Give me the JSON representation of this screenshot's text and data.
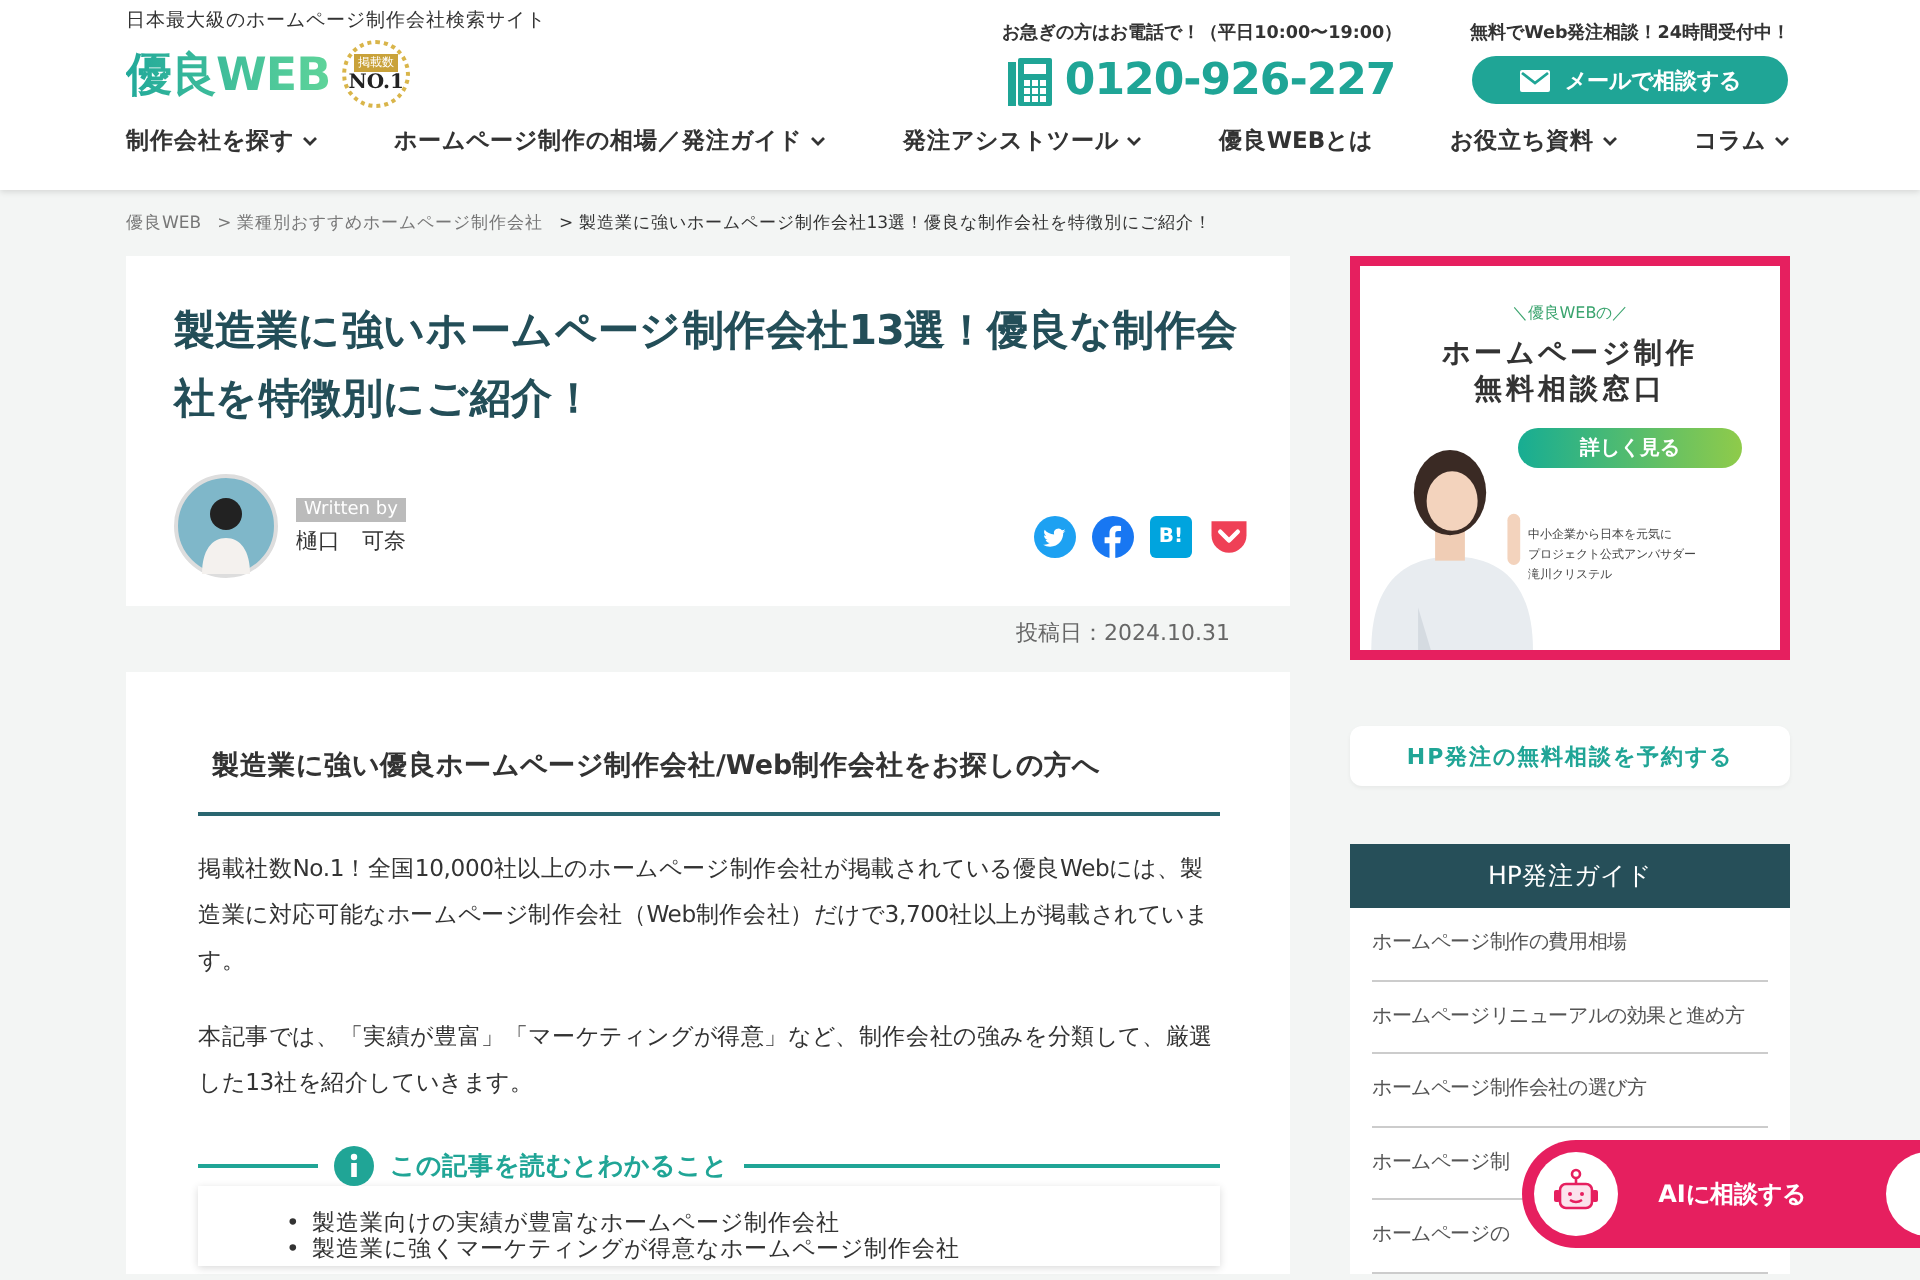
{
  "header": {
    "tagline": "日本最大級のホームページ制作会社検索サイト",
    "logo": "優良WEB",
    "badge": {
      "top": "掲載数",
      "main": "NO.1"
    },
    "phone_note": "お急ぎの方はお電話で！（平日10:00〜19:00）",
    "phone": "0120-926-227",
    "mail_note": "無料でWeb発注相談！24時間受付中！",
    "mail_button": "メールで相談する"
  },
  "nav": [
    {
      "label": "制作会社を探す",
      "dropdown": true
    },
    {
      "label": "ホームページ制作の相場／発注ガイド",
      "dropdown": true
    },
    {
      "label": "発注アシストツール",
      "dropdown": true
    },
    {
      "label": "優良WEBとは",
      "dropdown": false
    },
    {
      "label": "お役立ち資料",
      "dropdown": true
    },
    {
      "label": "コラム",
      "dropdown": true
    }
  ],
  "breadcrumbs": [
    "優良WEB",
    "> 業種別おすすめホームページ制作会社",
    "> 製造業に強いホームページ制作会社13選！優良な制作会社を特徴別にご紹介！"
  ],
  "article": {
    "title": "製造業に強いホームページ制作会社13選！優良な制作会社を特徴別にご紹介！",
    "author_label": "Written by",
    "author": "樋口　可奈",
    "share": [
      {
        "kind": "twitter"
      },
      {
        "kind": "facebook"
      },
      {
        "kind": "hatena",
        "label": "B!"
      },
      {
        "kind": "pocket"
      }
    ],
    "posted": "投稿日：2024.10.31",
    "section_heading": "製造業に強い優良ホームページ制作会社/Web制作会社をお探しの方へ",
    "paragraphs": [
      "掲載社数No.1！全国10,000社以上のホームページ制作会社が掲載されている優良Webには、製造業に対応可能なホームページ制作会社（Web制作会社）だけで3,700社以上が掲載されています。",
      "本記事では、「実績が豊富」「マーケティングが得意」など、制作会社の強みを分類して、厳選した13社を紹介していきます。"
    ],
    "summary": {
      "title": "この記事を読むとわかること",
      "bullet": "•",
      "items": [
        "製造業向けの実績が豊富なホームページ制作会社",
        "製造業に強くマーケティングが得意なホームページ制作会社"
      ]
    }
  },
  "sidebar": {
    "banner": {
      "kicker": "＼優良WEBの／",
      "headline": [
        "ホームページ制作",
        "無料相談窓口"
      ],
      "button": "詳しく見る",
      "caption": [
        "中小企業から日本を元気に",
        "プロジェクト公式アンバサダー",
        "滝川クリステル"
      ]
    },
    "reserve_button": "HP発注の無料相談を予約する",
    "guide": {
      "title": "HP発注ガイド",
      "items": [
        "ホームページ制作の費用相場",
        "ホームページリニューアルの効果と進め方",
        "ホームページ制作会社の選び方",
        "ホームページ制",
        "ホームページの"
      ]
    }
  },
  "ai_button": "AIに相談する"
}
